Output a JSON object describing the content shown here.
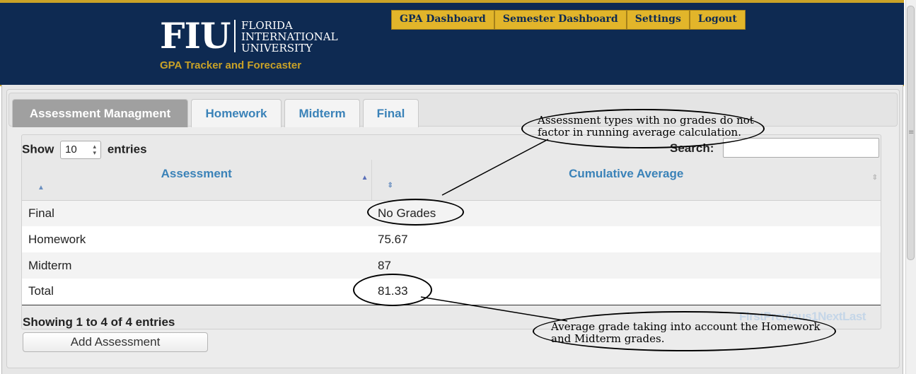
{
  "header": {
    "logo_mark": "FIU",
    "logo_lines": [
      "FLORIDA",
      "INTERNATIONAL",
      "UNIVERSITY"
    ],
    "tagline": "GPA Tracker and Forecaster"
  },
  "nav": {
    "items": [
      "GPA Dashboard",
      "Semester Dashboard",
      "Settings",
      "Logout"
    ]
  },
  "tabs": [
    "Assessment Managment",
    "Homework",
    "Midterm",
    "Final"
  ],
  "table": {
    "show_label": "Show",
    "entries_label": "entries",
    "length_value": "10",
    "search_label": "Search:",
    "search_value": "",
    "columns": [
      "Assessment",
      "Cumulative Average"
    ],
    "rows": [
      {
        "assessment": "Final",
        "average": "No Grades"
      },
      {
        "assessment": "Homework",
        "average": "75.67"
      },
      {
        "assessment": "Midterm",
        "average": "87"
      },
      {
        "assessment": "Total",
        "average": "81.33"
      }
    ],
    "info": "Showing 1 to 4 of 4 entries",
    "pager": {
      "first": "First",
      "previous": "Previous",
      "page": "1",
      "next": "Next",
      "last": "Last"
    }
  },
  "add_button": "Add Assessment",
  "annotations": {
    "top_note": "Assessment types with no grades do not factor in running average calculation.",
    "bottom_note": "Average grade taking into account the Homework and Midterm grades."
  }
}
